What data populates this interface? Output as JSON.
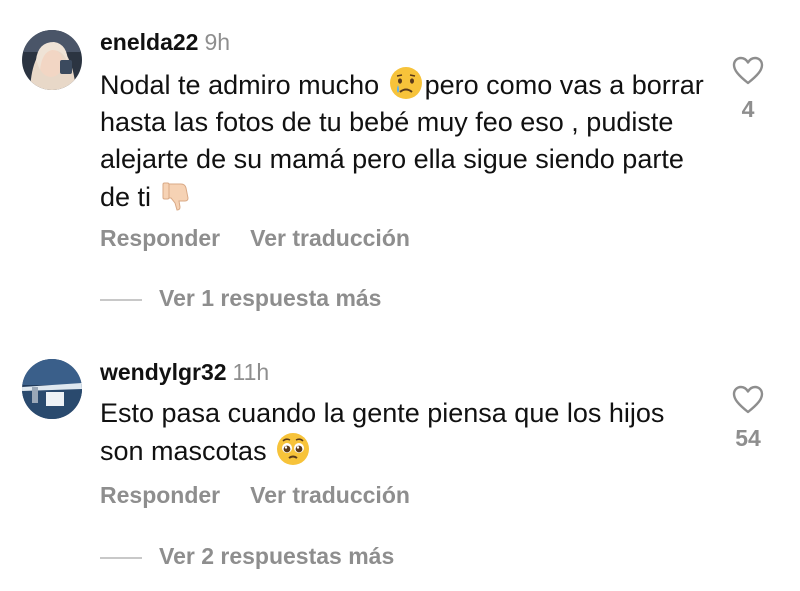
{
  "comments": [
    {
      "username": "enelda22",
      "time": "9h",
      "text_parts": [
        "Nodal te admiro mucho ",
        "pero como vas a borrar hasta las fotos de tu bebé muy feo eso , pudiste alejarte de su mamá pero ella sigue siendo parte de ti "
      ],
      "emojis": [
        "crying-face",
        "thumbs-down"
      ],
      "reply_label": "Responder",
      "translate_label": "Ver traducción",
      "like_count": "4",
      "view_replies": "Ver 1 respuesta más"
    },
    {
      "username": "wendylgr32",
      "time": "11h",
      "text_parts": [
        "Esto pasa cuando la gente piensa que los hijos son mascotas "
      ],
      "emojis": [
        "pleading-face"
      ],
      "reply_label": "Responder",
      "translate_label": "Ver traducción",
      "like_count": "54",
      "view_replies": "Ver 2 respuestas más"
    }
  ],
  "colors": {
    "secondary_text": "#8e8e8e",
    "divider": "#c8c8c8",
    "text": "#111111"
  }
}
